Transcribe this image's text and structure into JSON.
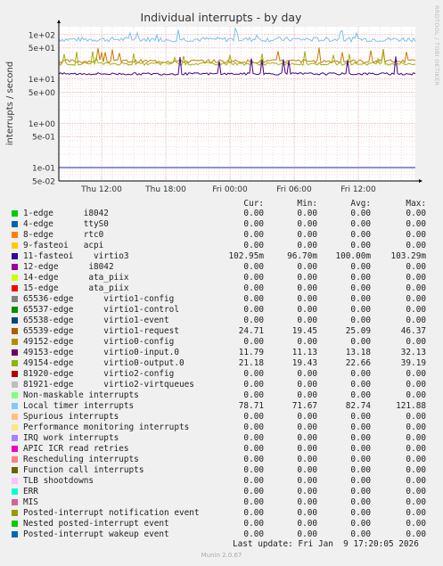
{
  "title": "Individual interrupts - by day",
  "ylabel": "interrupts / second",
  "watermark": "RRDTOOL / TOBI OETIKER",
  "footer": "Munin 2.0.67",
  "last_update": "Last update: Fri Jan  9 17:20:05 2026",
  "legend_headers": {
    "cur": "Cur:",
    "min": "Min:",
    "avg": "Avg:",
    "max": "Max:"
  },
  "chart_data": {
    "type": "line",
    "yscale": "log",
    "title": "Individual interrupts - by day",
    "ylabel": "interrupts / second",
    "ylim": [
      0.05,
      150
    ],
    "y_ticks": [
      "1e+02",
      "5e+01",
      "1e+01",
      "5e+00",
      "1e+00",
      "5e-01",
      "1e-01",
      "5e-02"
    ],
    "y_tick_values": [
      100,
      50,
      10,
      5,
      1,
      0.5,
      0.1,
      0.05
    ],
    "x_ticks": [
      "Thu 12:00",
      "Thu 18:00",
      "Fri 00:00",
      "Fri 06:00",
      "Fri 12:00"
    ],
    "grid": true,
    "series": [
      {
        "name": "Local timer interrupts",
        "color": "#7ec0ee",
        "level": 78,
        "noise": 0.12,
        "spike": 1.5
      },
      {
        "name": "65539-edge virtio1-request",
        "color": "#cc7a00",
        "level": 25,
        "noise": 0.09,
        "spike": 1.8
      },
      {
        "name": "49154-edge virtio0-output.0",
        "color": "#a0b010",
        "level": 22,
        "noise": 0.07,
        "spike": 1.6
      },
      {
        "name": "49153-edge virtio0-input.0",
        "color": "#4b0082",
        "level": 13,
        "noise": 0.06,
        "spike": 2.2
      },
      {
        "name": "11-fasteoi virtio3",
        "color": "#2020a0",
        "level": 0.1,
        "noise": 0.0,
        "spike": 1.0
      }
    ]
  },
  "legend": [
    {
      "label": "1-edge      i8042",
      "color": "#00cc00",
      "cur": "0.00",
      "min": "0.00",
      "avg": "0.00",
      "max": "0.00"
    },
    {
      "label": "4-edge      ttyS0",
      "color": "#0066b3",
      "cur": "0.00",
      "min": "0.00",
      "avg": "0.00",
      "max": "0.00"
    },
    {
      "label": "8-edge      rtc0",
      "color": "#ff8000",
      "cur": "0.00",
      "min": "0.00",
      "avg": "0.00",
      "max": "0.00"
    },
    {
      "label": "9-fasteoi   acpi",
      "color": "#ffcc00",
      "cur": "0.00",
      "min": "0.00",
      "avg": "0.00",
      "max": "0.00"
    },
    {
      "label": "11-fasteoi    virtio3",
      "color": "#330099",
      "cur": "102.95m",
      "min": "96.70m",
      "avg": "100.00m",
      "max": "103.29m"
    },
    {
      "label": "12-edge      i8042",
      "color": "#990099",
      "cur": "0.00",
      "min": "0.00",
      "avg": "0.00",
      "max": "0.00"
    },
    {
      "label": "14-edge      ata_piix",
      "color": "#ccff00",
      "cur": "0.00",
      "min": "0.00",
      "avg": "0.00",
      "max": "0.00"
    },
    {
      "label": "15-edge      ata_piix",
      "color": "#ff0000",
      "cur": "0.00",
      "min": "0.00",
      "avg": "0.00",
      "max": "0.00"
    },
    {
      "label": "65536-edge      virtio1-config",
      "color": "#808080",
      "cur": "0.00",
      "min": "0.00",
      "avg": "0.00",
      "max": "0.00"
    },
    {
      "label": "65537-edge      virtio1-control",
      "color": "#008f00",
      "cur": "0.00",
      "min": "0.00",
      "avg": "0.00",
      "max": "0.00"
    },
    {
      "label": "65538-edge      virtio1-event",
      "color": "#00487d",
      "cur": "0.00",
      "min": "0.00",
      "avg": "0.00",
      "max": "0.00"
    },
    {
      "label": "65539-edge      virtio1-request",
      "color": "#b35a00",
      "cur": "24.71",
      "min": "19.45",
      "avg": "25.09",
      "max": "46.37"
    },
    {
      "label": "49152-edge      virtio0-config",
      "color": "#b38f00",
      "cur": "0.00",
      "min": "0.00",
      "avg": "0.00",
      "max": "0.00"
    },
    {
      "label": "49153-edge      virtio0-input.0",
      "color": "#6b006b",
      "cur": "11.79",
      "min": "11.13",
      "avg": "13.18",
      "max": "32.13"
    },
    {
      "label": "49154-edge      virtio0-output.0",
      "color": "#8fb300",
      "cur": "21.18",
      "min": "19.43",
      "avg": "22.66",
      "max": "39.19"
    },
    {
      "label": "81920-edge      virtio2-config",
      "color": "#b30000",
      "cur": "0.00",
      "min": "0.00",
      "avg": "0.00",
      "max": "0.00"
    },
    {
      "label": "81921-edge      virtio2-virtqueues",
      "color": "#bebebe",
      "cur": "0.00",
      "min": "0.00",
      "avg": "0.00",
      "max": "0.00"
    },
    {
      "label": "Non-maskable interrupts",
      "color": "#80ff80",
      "cur": "0.00",
      "min": "0.00",
      "avg": "0.00",
      "max": "0.00"
    },
    {
      "label": "Local timer interrupts",
      "color": "#80c9ff",
      "cur": "78.71",
      "min": "71.67",
      "avg": "82.74",
      "max": "121.88"
    },
    {
      "label": "Spurious interrupts",
      "color": "#ffc080",
      "cur": "0.00",
      "min": "0.00",
      "avg": "0.00",
      "max": "0.00"
    },
    {
      "label": "Performance monitoring interrupts",
      "color": "#ffe680",
      "cur": "0.00",
      "min": "0.00",
      "avg": "0.00",
      "max": "0.00"
    },
    {
      "label": "IRQ work interrupts",
      "color": "#aa80ff",
      "cur": "0.00",
      "min": "0.00",
      "avg": "0.00",
      "max": "0.00"
    },
    {
      "label": "APIC ICR read retries",
      "color": "#ee00cc",
      "cur": "0.00",
      "min": "0.00",
      "avg": "0.00",
      "max": "0.00"
    },
    {
      "label": "Rescheduling interrupts",
      "color": "#ff8080",
      "cur": "0.00",
      "min": "0.00",
      "avg": "0.00",
      "max": "0.00"
    },
    {
      "label": "Function call interrupts",
      "color": "#666600",
      "cur": "0.00",
      "min": "0.00",
      "avg": "0.00",
      "max": "0.00"
    },
    {
      "label": "TLB shootdowns",
      "color": "#ffbfff",
      "cur": "0.00",
      "min": "0.00",
      "avg": "0.00",
      "max": "0.00"
    },
    {
      "label": "ERR",
      "color": "#00ffcc",
      "cur": "0.00",
      "min": "0.00",
      "avg": "0.00",
      "max": "0.00"
    },
    {
      "label": "MIS",
      "color": "#cc6699",
      "cur": "0.00",
      "min": "0.00",
      "avg": "0.00",
      "max": "0.00"
    },
    {
      "label": "Posted-interrupt notification event",
      "color": "#999900",
      "cur": "0.00",
      "min": "0.00",
      "avg": "0.00",
      "max": "0.00"
    },
    {
      "label": "Nested posted-interrupt event",
      "color": "#00cc00",
      "cur": "0.00",
      "min": "0.00",
      "avg": "0.00",
      "max": "0.00"
    },
    {
      "label": "Posted-interrupt wakeup event",
      "color": "#0066b3",
      "cur": "0.00",
      "min": "0.00",
      "avg": "0.00",
      "max": "0.00"
    }
  ]
}
